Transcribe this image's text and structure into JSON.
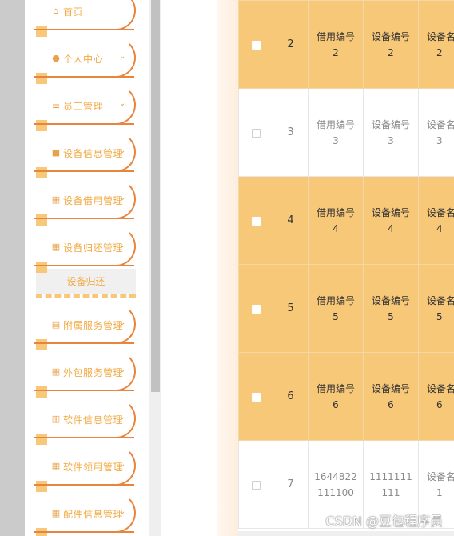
{
  "sidebar": {
    "items": [
      {
        "label": "首页",
        "icon": "home-icon",
        "glyph": "⌂",
        "chevron": false
      },
      {
        "label": "个人中心",
        "icon": "person-icon",
        "glyph": "●",
        "chevron": true
      },
      {
        "label": "员工管理",
        "icon": "sliders-icon",
        "glyph": "☰",
        "chevron": true
      },
      {
        "label": "设备信息管理",
        "icon": "chat-icon",
        "glyph": "■",
        "chevron": true
      },
      {
        "label": "设备借用管理",
        "icon": "grid-icon",
        "glyph": "▦",
        "chevron": true
      },
      {
        "label": "设备归还管理",
        "icon": "grid-icon",
        "glyph": "▦",
        "chevron": true
      },
      {
        "label": "附属服务管理",
        "icon": "clipboard-icon",
        "glyph": "▤",
        "chevron": true
      },
      {
        "label": "外包服务管理",
        "icon": "grid-icon",
        "glyph": "▦",
        "chevron": true
      },
      {
        "label": "软件信息管理",
        "icon": "bar-chart-icon",
        "glyph": "▥",
        "chevron": true
      },
      {
        "label": "软件领用管理",
        "icon": "grid-icon",
        "glyph": "▦",
        "chevron": true
      },
      {
        "label": "配件信息管理",
        "icon": "grid-icon",
        "glyph": "▦",
        "chevron": true
      }
    ],
    "sub_item": "设备归还",
    "chevron_glyph": "⌄"
  },
  "table": {
    "rows": [
      {
        "num": "2",
        "a": [
          "借用编号",
          "2"
        ],
        "b": [
          "设备编号",
          "2"
        ],
        "c": [
          "设备名",
          "2"
        ],
        "highlight": true
      },
      {
        "num": "3",
        "a": [
          "借用编号",
          "3"
        ],
        "b": [
          "设备编号",
          "3"
        ],
        "c": [
          "设备名",
          "3"
        ],
        "highlight": false
      },
      {
        "num": "4",
        "a": [
          "借用编号",
          "4"
        ],
        "b": [
          "设备编号",
          "4"
        ],
        "c": [
          "设备名",
          "4"
        ],
        "highlight": true
      },
      {
        "num": "5",
        "a": [
          "借用编号",
          "5"
        ],
        "b": [
          "设备编号",
          "5"
        ],
        "c": [
          "设备名",
          "5"
        ],
        "highlight": true
      },
      {
        "num": "6",
        "a": [
          "借用编号",
          "6"
        ],
        "b": [
          "设备编号",
          "6"
        ],
        "c": [
          "设备名",
          "6"
        ],
        "highlight": true
      },
      {
        "num": "7",
        "a": [
          "1644822",
          "111100"
        ],
        "b": [
          "1111111",
          "111"
        ],
        "c": [
          "设备名",
          "1"
        ],
        "highlight": false
      }
    ]
  },
  "watermark": "CSDN @豆包程序员",
  "colors": {
    "accent": "#f8c879",
    "menu_text": "#f2ab45",
    "curve": "#e8843c"
  }
}
